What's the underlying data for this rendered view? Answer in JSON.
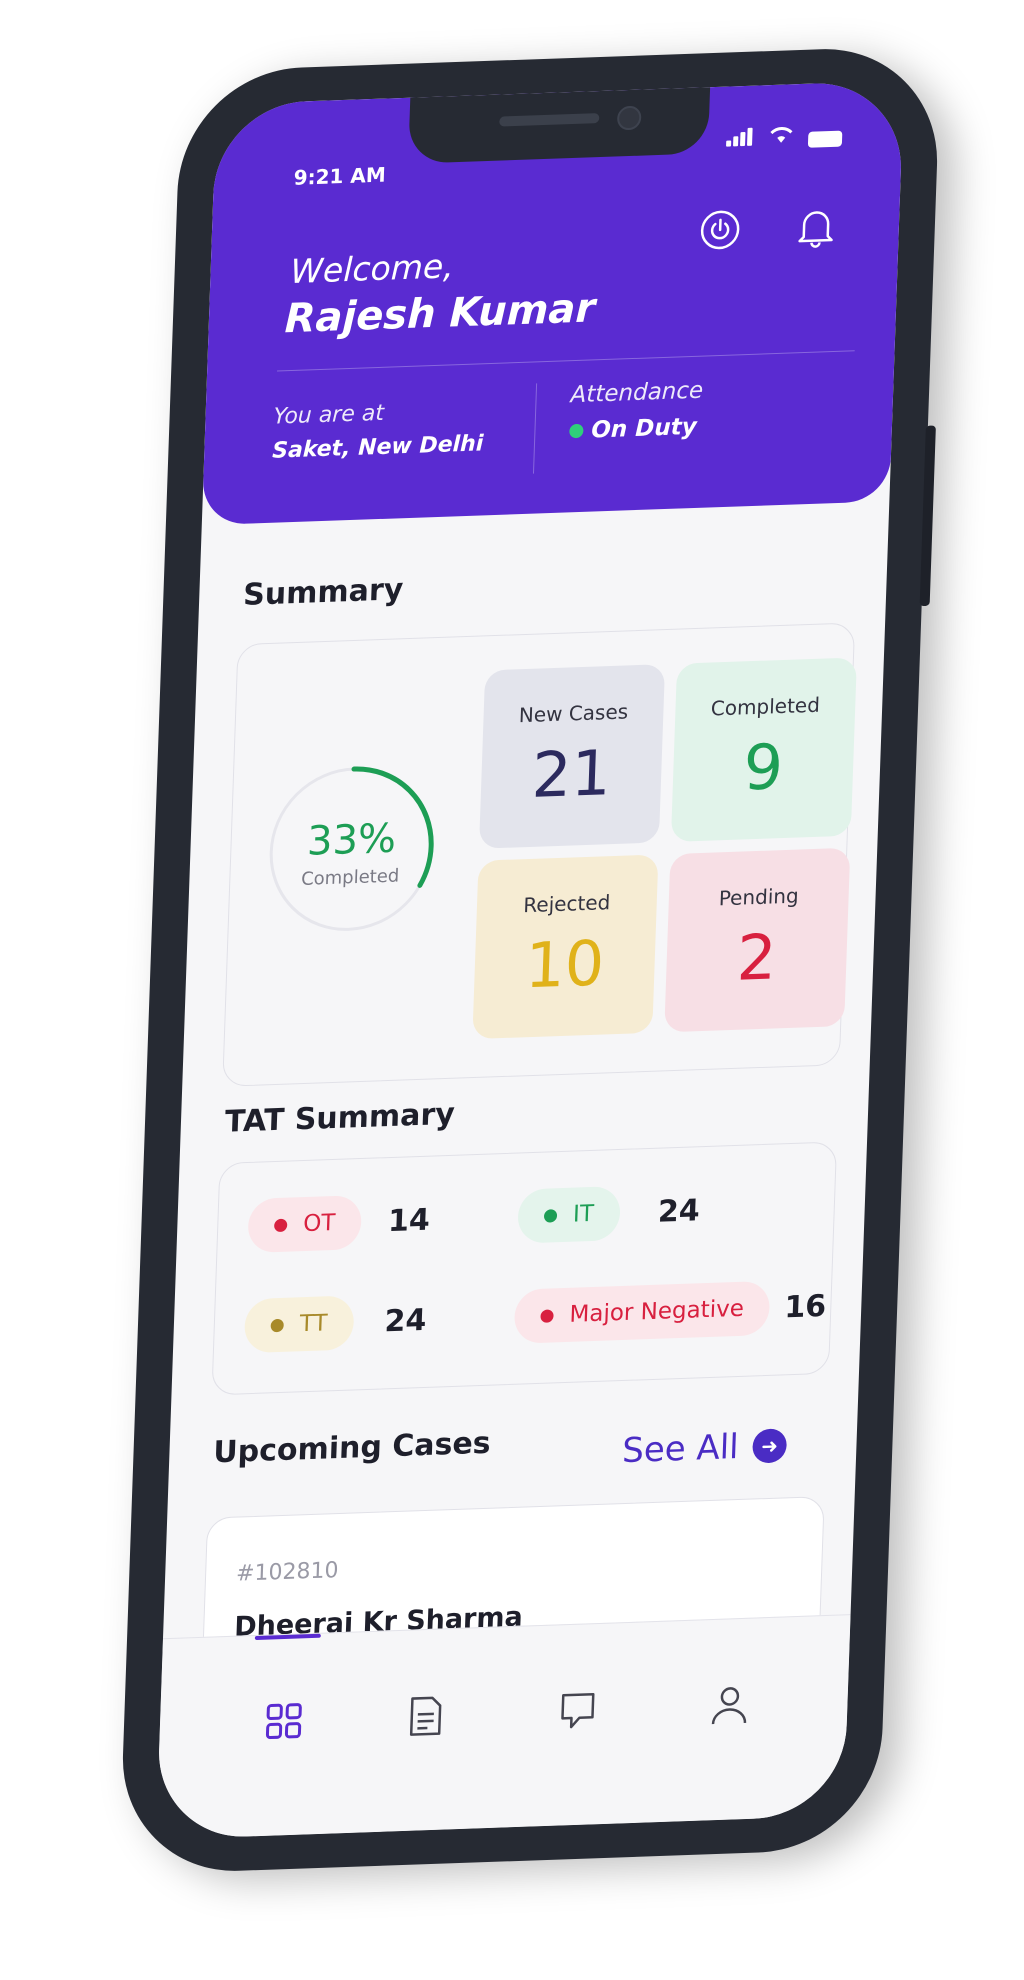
{
  "status_bar": {
    "time": "9:21 AM"
  },
  "header": {
    "welcome": "Welcome,",
    "user_name": "Rajesh Kumar",
    "location_label": "You are at",
    "location_value": "Saket, New Delhi",
    "attendance_label": "Attendance",
    "attendance_value": "On Duty",
    "attendance_color": "#2fd07a",
    "icons": [
      "power-icon",
      "bell-icon"
    ]
  },
  "summary": {
    "title": "Summary",
    "completed_pct": 33,
    "completed_pct_label": "33%",
    "completed_label": "Completed",
    "tiles": [
      {
        "label": "New Cases",
        "value": "21",
        "color": "#2c2a5e"
      },
      {
        "label": "Completed",
        "value": "9",
        "color": "#1d9e55"
      },
      {
        "label": "Rejected",
        "value": "10",
        "color": "#e0b21a"
      },
      {
        "label": "Pending",
        "value": "2",
        "color": "#d8203f"
      }
    ]
  },
  "tat_summary": {
    "title": "TAT Summary",
    "items": [
      {
        "label": "OT",
        "count": "14",
        "color": "#d8203f",
        "bg": "#fbe6ea"
      },
      {
        "label": "IT",
        "count": "24",
        "color": "#1d9e55",
        "bg": "#e4f4ec"
      },
      {
        "label": "TT",
        "count": "24",
        "color": "#a88a2a",
        "bg": "#f8f1dc"
      },
      {
        "label": "Major Negative",
        "count": "16",
        "color": "#d8203f",
        "bg": "#fbe6ea"
      }
    ]
  },
  "upcoming": {
    "title": "Upcoming Cases",
    "see_all": "See All",
    "cases": [
      {
        "id": "#102810",
        "name": "Dheeraj Kr Sharma"
      }
    ]
  },
  "bottom_nav": {
    "items": [
      "dashboard-icon",
      "document-icon",
      "chat-icon",
      "profile-icon"
    ],
    "active": 0
  }
}
